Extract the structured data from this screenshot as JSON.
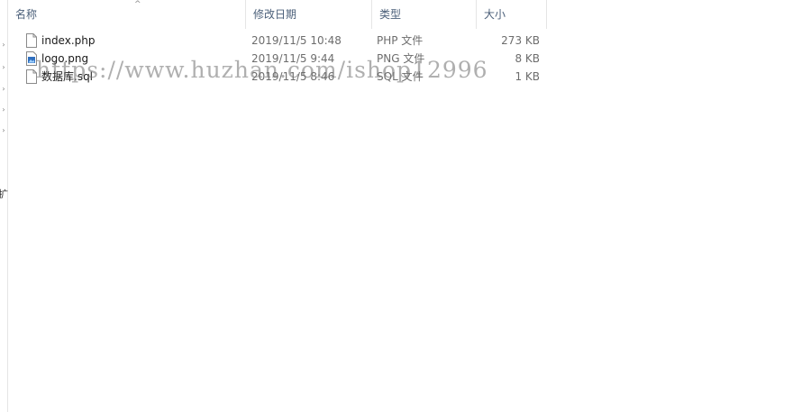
{
  "columns": {
    "name": "名称",
    "date": "修改日期",
    "type": "类型",
    "size": "大小"
  },
  "files": [
    {
      "icon": "document-icon",
      "name": "index.php",
      "date": "2019/11/5 10:48",
      "type": "PHP 文件",
      "size": "273 KB"
    },
    {
      "icon": "image-file-icon",
      "name": "logo.png",
      "date": "2019/11/5 9:44",
      "type": "PNG 文件",
      "size": "8 KB"
    },
    {
      "icon": "document-icon",
      "name": "数据库.sql",
      "date": "2019/11/5 8:46",
      "type": "SQL 文件",
      "size": "1 KB"
    }
  ],
  "watermark": "https://www.huzhan.com/ishop12996",
  "nav_cut_text": "扩",
  "colors": {
    "header_text": "#4c607a",
    "meta_text": "#6d6d6d",
    "divider": "#e5e5e5"
  }
}
